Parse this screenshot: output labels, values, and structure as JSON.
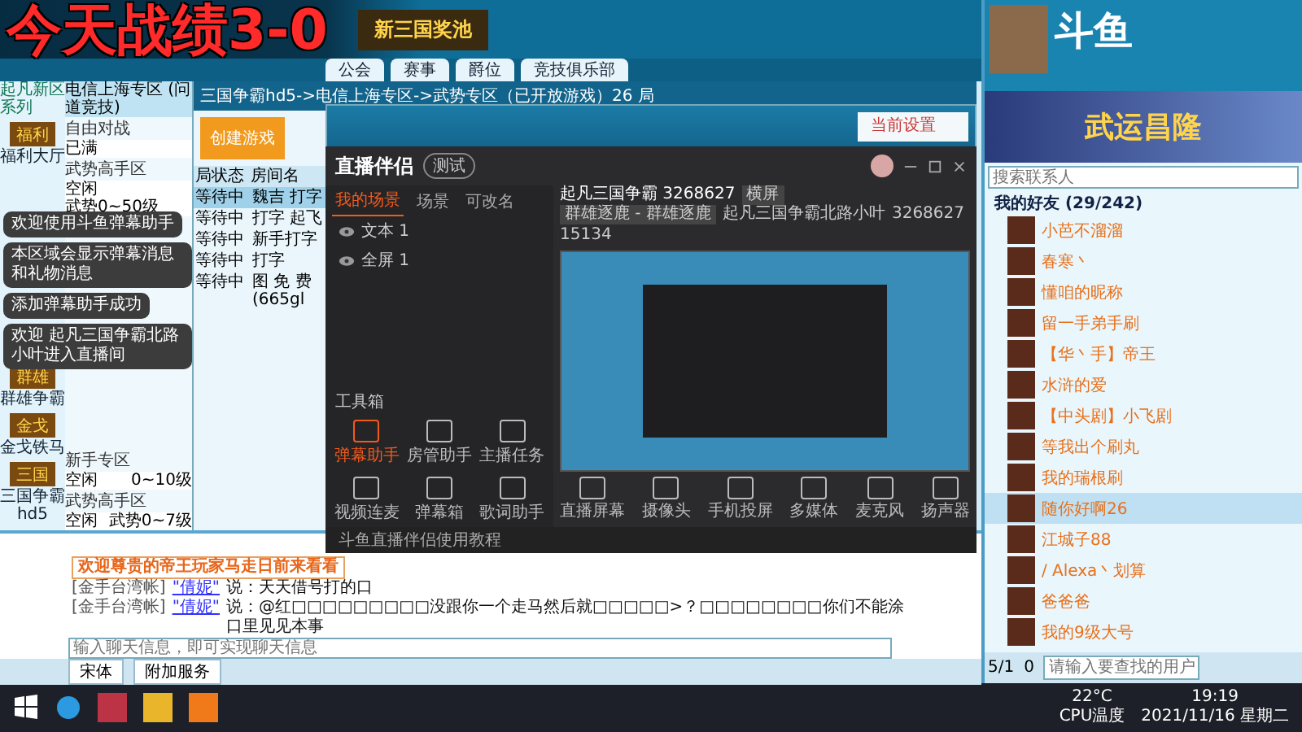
{
  "caption": "今天战绩3-0",
  "tabs": [
    {
      "label": "公会",
      "selected": false
    },
    {
      "label": "赛事",
      "selected": false
    },
    {
      "label": "爵位",
      "selected": false
    },
    {
      "label": "竞技俱乐部",
      "selected": false
    }
  ],
  "banner": "新三国奖池",
  "sidebar": {
    "header": "起凡新区系列",
    "items": [
      {
        "label": "福利大厅",
        "badge": "福利"
      },
      {
        "label": "群雄争霸",
        "badge": "群雄"
      },
      {
        "label": "金戈铁马",
        "badge": "金戈"
      },
      {
        "label": "三国争霸hd5",
        "badge": "三国"
      }
    ]
  },
  "zones": {
    "title": "电信上海专区 (问道竞技)",
    "rooms": [
      {
        "name": "自由对战",
        "status": "已满"
      },
      {
        "name": "武势高手区",
        "status": "空闲",
        "range": "武势0~50级"
      },
      {
        "name": "新手专区",
        "status": "空闲",
        "range": "0~10级"
      },
      {
        "name": "武势高手区",
        "status": "空闲",
        "range": "武势0~7级"
      }
    ]
  },
  "breadcrumb": "三国争霸hd5->电信上海专区->武势专区（已开放游戏）26 局",
  "create_button": "创建游戏",
  "table": {
    "columns": [
      "局状态",
      "房间名"
    ],
    "rows": [
      {
        "status": "等待中",
        "name": "魏吉 打字",
        "selected": true
      },
      {
        "status": "等待中",
        "name": "打字 起飞",
        "selected": false
      },
      {
        "status": "等待中",
        "name": "新手打字",
        "selected": false
      },
      {
        "status": "等待中",
        "name": "打字",
        "selected": false
      },
      {
        "status": "等待中",
        "name": "图 免 费 (665gl",
        "selected": false
      }
    ]
  },
  "settings_label": "当前设置",
  "toasts": [
    "欢迎使用斗鱼弹幕助手",
    "本区域会显示弹幕消息和礼物消息",
    "添加弹幕助手成功",
    "欢迎 起凡三国争霸北路小叶进入直播间"
  ],
  "stream": {
    "logo": "直播伴侣",
    "version": "测试",
    "scene_tabs": [
      {
        "label": "我的场景",
        "selected": true
      },
      {
        "label": "场景",
        "selected": false
      },
      {
        "label": "可改名",
        "selected": false
      }
    ],
    "sources": [
      "文本 1",
      "全屏 1"
    ],
    "room_title": "起凡三国争霸 3268627",
    "room_tag": "横屏",
    "category": "群雄逐鹿 - 群雄逐鹿",
    "room_name": "起凡三国争霸北路小叶",
    "room_id": "3268627",
    "viewers": "15134",
    "toolbox_title": "工具箱",
    "tools": [
      {
        "label": "弹幕助手",
        "active": true
      },
      {
        "label": "房管助手",
        "active": false
      },
      {
        "label": "主播任务",
        "active": false
      },
      {
        "label": "视频连麦",
        "active": false
      },
      {
        "label": "弹幕箱",
        "active": false
      },
      {
        "label": "歌词助手",
        "active": false
      }
    ],
    "controls": [
      "直播屏幕",
      "摄像头",
      "手机投屏",
      "多媒体",
      "麦克风",
      "扬声器"
    ],
    "tutorial": "斗鱼直播伴侣使用教程"
  },
  "chat": {
    "system": "欢迎尊贵的帝王玩家马走日前来看看",
    "lines": [
      {
        "sender": "[金手台湾帐]",
        "name": "\"倩妮\"",
        "text": "说：天天借号打的口"
      },
      {
        "sender": "[金手台湾帐]",
        "name": "\"倩妮\"",
        "text": "说：@红□□□□□□□□□没跟你一个走马然后就□□□□□>？□□□□□□□□你们不能涂口里见见本事"
      }
    ],
    "placeholder": "输入聊天信息，即可实现聊天信息",
    "font": "宋体",
    "mode": "附加服务"
  },
  "friends": {
    "logo": "斗鱼",
    "promo": "武运昌隆",
    "search_placeholder": "搜索联系人",
    "group": "我的好友 (29/242)",
    "items": [
      {
        "name": "小芭不溜溜",
        "selected": false
      },
      {
        "name": "春寒丶",
        "selected": false
      },
      {
        "name": "懂咱的昵称",
        "selected": false
      },
      {
        "name": "留一手弟手刷",
        "selected": false
      },
      {
        "name": "【华丶手】帝王",
        "selected": false
      },
      {
        "name": "水浒的爱",
        "selected": false
      },
      {
        "name": "【中头剧】小飞剧",
        "selected": false
      },
      {
        "name": "等我出个刷丸",
        "selected": false
      },
      {
        "name": "我的瑞根刷",
        "selected": false
      },
      {
        "name": "随你好啊26",
        "selected": true
      },
      {
        "name": "江城子88",
        "selected": false
      },
      {
        "name": "/ Alexa丶划算",
        "selected": false
      },
      {
        "name": "爸爸爸",
        "selected": false
      },
      {
        "name": "我的9级大号",
        "selected": false
      }
    ],
    "status": "5/1",
    "count": "0",
    "search2_placeholder": "请输入要查找的用户"
  },
  "taskbar": {
    "temp": "22°C",
    "cpu": "CPU温度",
    "time": "19:19",
    "date": "2021/11/16 星期二"
  }
}
